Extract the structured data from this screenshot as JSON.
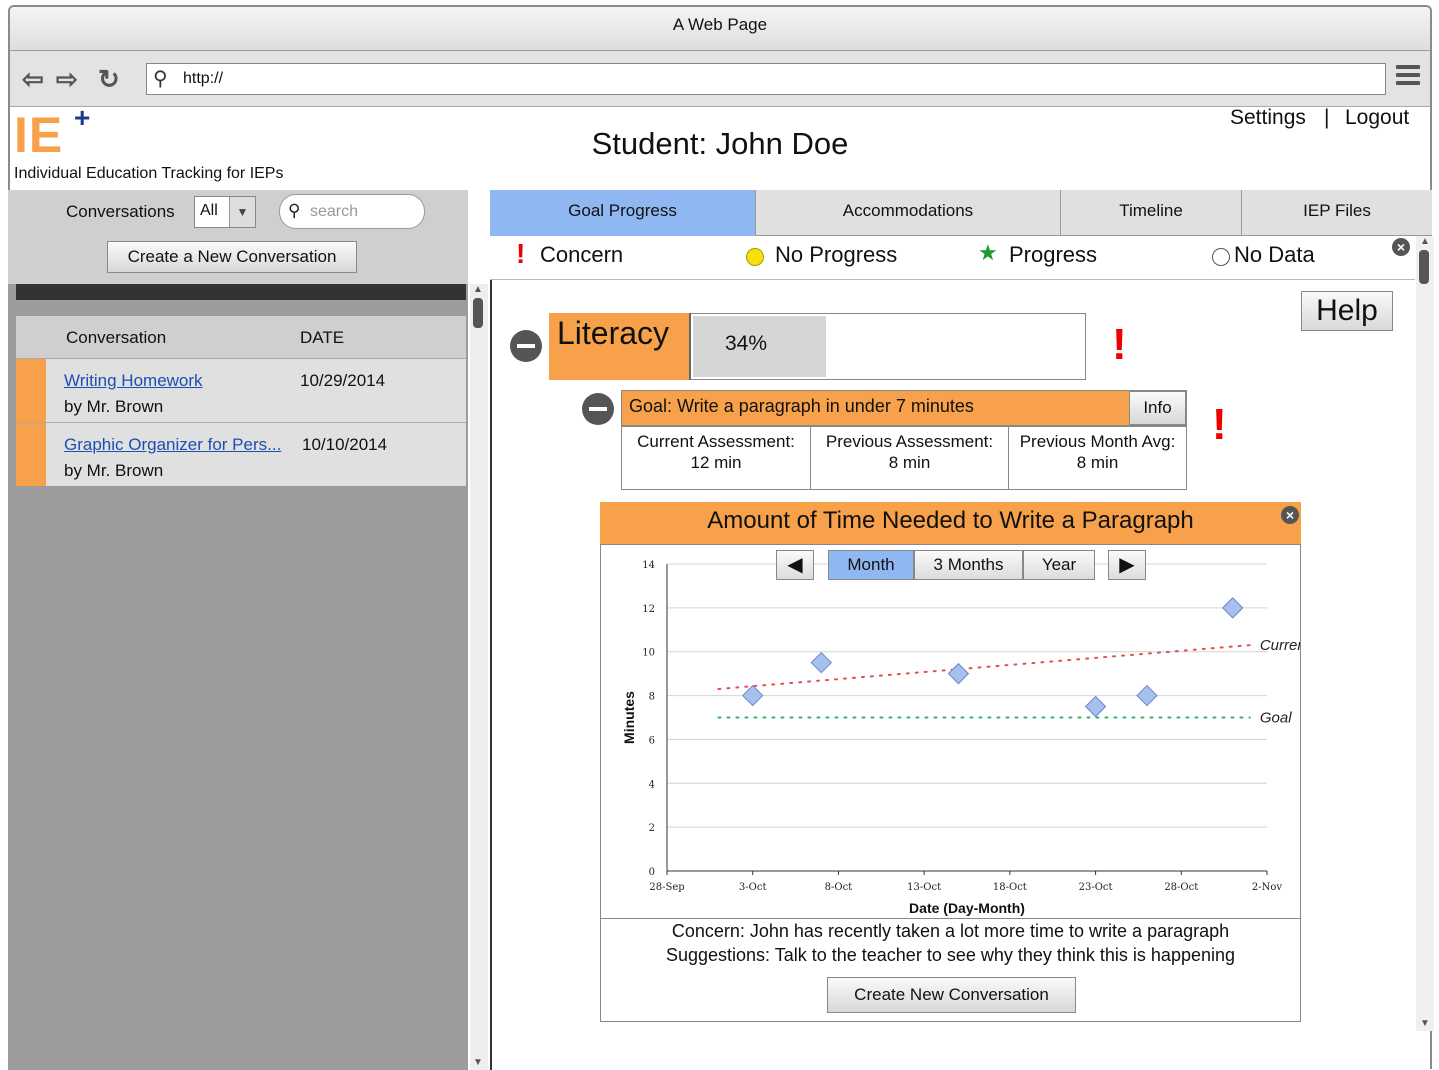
{
  "browser": {
    "title": "A Web Page",
    "url": "http://"
  },
  "header": {
    "logo_text": "IE",
    "logo_plus": "+",
    "logo_subtitle": "Individual Education Tracking for IEPs",
    "student_title": "Student: John Doe",
    "settings_label": "Settings",
    "separator": "|",
    "logout_label": "Logout"
  },
  "sidebar": {
    "conversations_label": "Conversations",
    "filter_value": "All",
    "search_placeholder": "search",
    "new_conversation_label": "Create a New Conversation",
    "columns": [
      "Conversation",
      "DATE"
    ],
    "rows": [
      {
        "title": "Writing Homework",
        "author": "by Mr. Brown",
        "date": "10/29/2014"
      },
      {
        "title": "Graphic Organizer for Pers...",
        "author": "by Mr. Brown",
        "date": "10/10/2014"
      }
    ]
  },
  "tabs": [
    "Goal Progress",
    "Accommodations",
    "Timeline",
    "IEP Files"
  ],
  "legend": {
    "concern": "Concern",
    "no_progress": "No Progress",
    "progress": "Progress",
    "no_data": "No Data"
  },
  "help_label": "Help",
  "literacy": {
    "label": "Literacy",
    "percent_text": "34%",
    "percent": 0.34,
    "status_mark": "!"
  },
  "goal": {
    "text": "Goal: Write a paragraph in under 7 minutes",
    "info_label": "Info",
    "status_mark": "!",
    "current_label": "Current Assessment:",
    "current_value": "12 min",
    "previous_label": "Previous Assessment:",
    "previous_value": "8 min",
    "month_avg_label": "Previous Month Avg:",
    "month_avg_value": "8 min"
  },
  "chart_panel": {
    "title": "Amount of Time Needed to Write a Paragraph",
    "periods": [
      "Month",
      "3 Months",
      "Year"
    ],
    "selected_period": "Month",
    "concern_text": "Concern: John has recently taken a lot more time to write a paragraph",
    "suggestion_text": "Suggestions: Talk to the teacher to see why they think this is happening",
    "create_label": "Create New Conversation"
  },
  "chart_data": {
    "type": "scatter",
    "xlabel": "Date (Day-Month)",
    "ylabel": "Minutes",
    "x_ticks": [
      "28-Sep",
      "3-Oct",
      "8-Oct",
      "13-Oct",
      "18-Oct",
      "23-Oct",
      "28-Oct",
      "2-Nov"
    ],
    "y_ticks": [
      0,
      2,
      4,
      6,
      8,
      10,
      12,
      14
    ],
    "ylim": [
      0,
      14
    ],
    "xlim": [
      "28-Sep",
      "2-Nov"
    ],
    "points": [
      {
        "x": "3-Oct",
        "y": 8
      },
      {
        "x": "7-Oct",
        "y": 9.5
      },
      {
        "x": "15-Oct",
        "y": 9
      },
      {
        "x": "23-Oct",
        "y": 7.5
      },
      {
        "x": "26-Oct",
        "y": 8
      },
      {
        "x": "31-Oct",
        "y": 12
      }
    ],
    "lines": [
      {
        "name": "Current",
        "style": "dotted",
        "color": "#e05050",
        "from": {
          "x": "1-Oct",
          "y": 8.3
        },
        "to": {
          "x": "1-Nov",
          "y": 10.3
        }
      },
      {
        "name": "Goal",
        "style": "dotted",
        "color": "#30b070",
        "from": {
          "x": "1-Oct",
          "y": 7
        },
        "to": {
          "x": "1-Nov",
          "y": 7
        }
      }
    ],
    "grid": true,
    "marker_color": "#a8c0ee"
  }
}
